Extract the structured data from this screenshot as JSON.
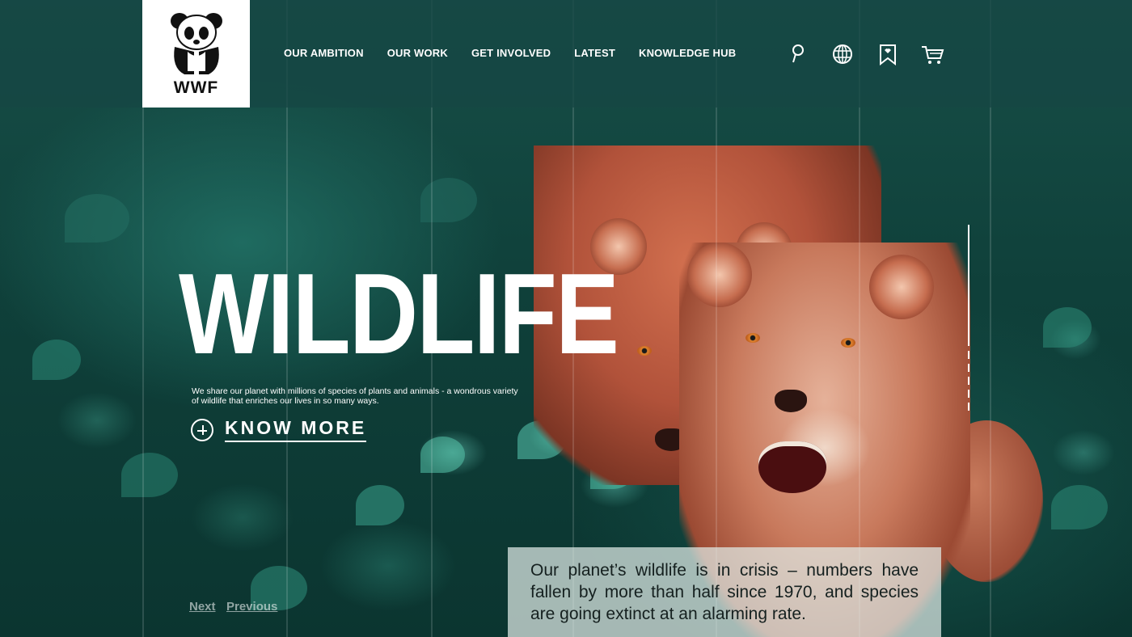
{
  "brand": {
    "logo_text": "WWF"
  },
  "nav": {
    "items": [
      {
        "label": "OUR AMBITION"
      },
      {
        "label": "OUR WORK"
      },
      {
        "label": "GET INVOLVED"
      },
      {
        "label": "LATEST"
      },
      {
        "label": "KNOWLEDGE HUB"
      }
    ]
  },
  "header_icons": [
    "search-icon",
    "globe-icon",
    "bookmark-icon",
    "cart-icon"
  ],
  "hero": {
    "title": "WILDLIFE",
    "description": "We share our planet with millions of species of plants and animals - a wondrous variety of wildlife that enriches our lives in so many ways.",
    "cta_label": "KNOW MORE"
  },
  "pager": {
    "next": "Next",
    "previous": "Previous"
  },
  "info_card": {
    "text": "Our planet’s wildlife is in crisis – numbers have fallen by more than half since 1970, and species are going extinct at an alarming rate."
  },
  "colors": {
    "header_bg": "#164644",
    "accent_text": "#ffffff",
    "card_bg": "#e1ebe8"
  }
}
